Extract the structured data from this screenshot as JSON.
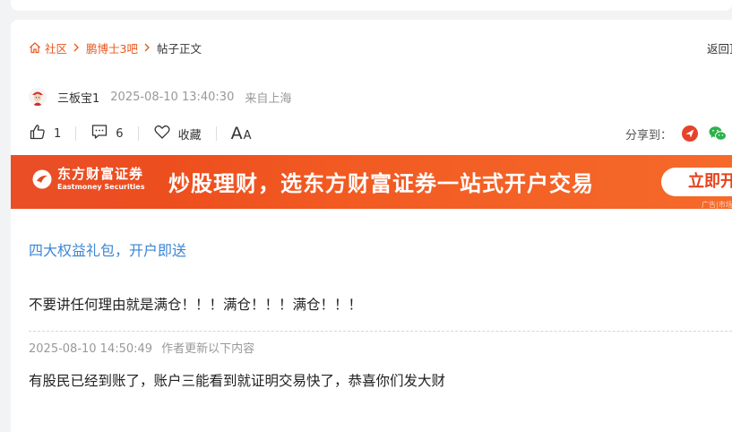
{
  "breadcrumb": {
    "community": "社区",
    "forum": "鹏博士3吧",
    "current": "帖子正文",
    "back": "返回顶部"
  },
  "author": {
    "name": "三板宝1",
    "time": "2025-08-10 13:40:30",
    "location": "来自上海"
  },
  "actions": {
    "likes": "1",
    "comments": "6",
    "favorite": "收藏",
    "font_big": "A",
    "font_small": "A",
    "share_label": "分享到："
  },
  "banner": {
    "brand_cn": "东方财富证券",
    "brand_en": "Eastmoney Securities",
    "slogan": "炒股理财，选东方财富证券一站式开户交易",
    "cta": "立即开户",
    "ad_tag": "广告|市场有风险"
  },
  "post": {
    "promo_link": "四大权益礼包，开户即送",
    "content": "不要讲任何理由就是满仓！！！满仓！！！满仓！！！",
    "update_time": "2025-08-10 14:50:49",
    "update_label": "作者更新以下内容",
    "update_content": "有股民已经到账了，账户三能看到就证明交易快了，恭喜你们发大财"
  },
  "colors": {
    "accent": "#e8551c",
    "link": "#3d86d6",
    "banner": "#e8431a"
  }
}
